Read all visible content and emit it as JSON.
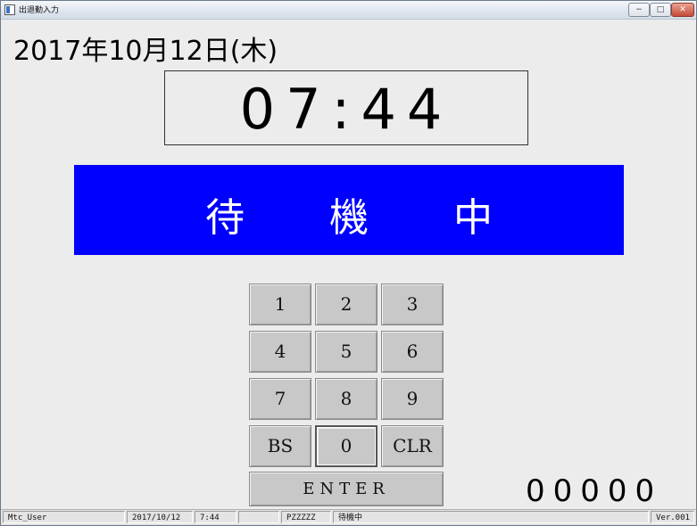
{
  "window": {
    "title": "出退勤入力"
  },
  "titlebar_buttons": {
    "minimize": "−",
    "maximize": "□",
    "close": "✕"
  },
  "date": "2017年10月12日(木)",
  "clock": "07:44",
  "status_banner": {
    "text": "待機中",
    "color": "#0000ff"
  },
  "keypad": {
    "keys": [
      "1",
      "2",
      "3",
      "4",
      "5",
      "6",
      "7",
      "8",
      "9",
      "BS",
      "0",
      "CLR"
    ],
    "enter": "ENTER"
  },
  "counter": "00000",
  "statusbar": {
    "user": "Mtc_User",
    "date": "2017/10/12",
    "time": "7:44",
    "blank": "",
    "code": "PZZZZZ",
    "state": "待機中",
    "version": "Ver.001"
  }
}
